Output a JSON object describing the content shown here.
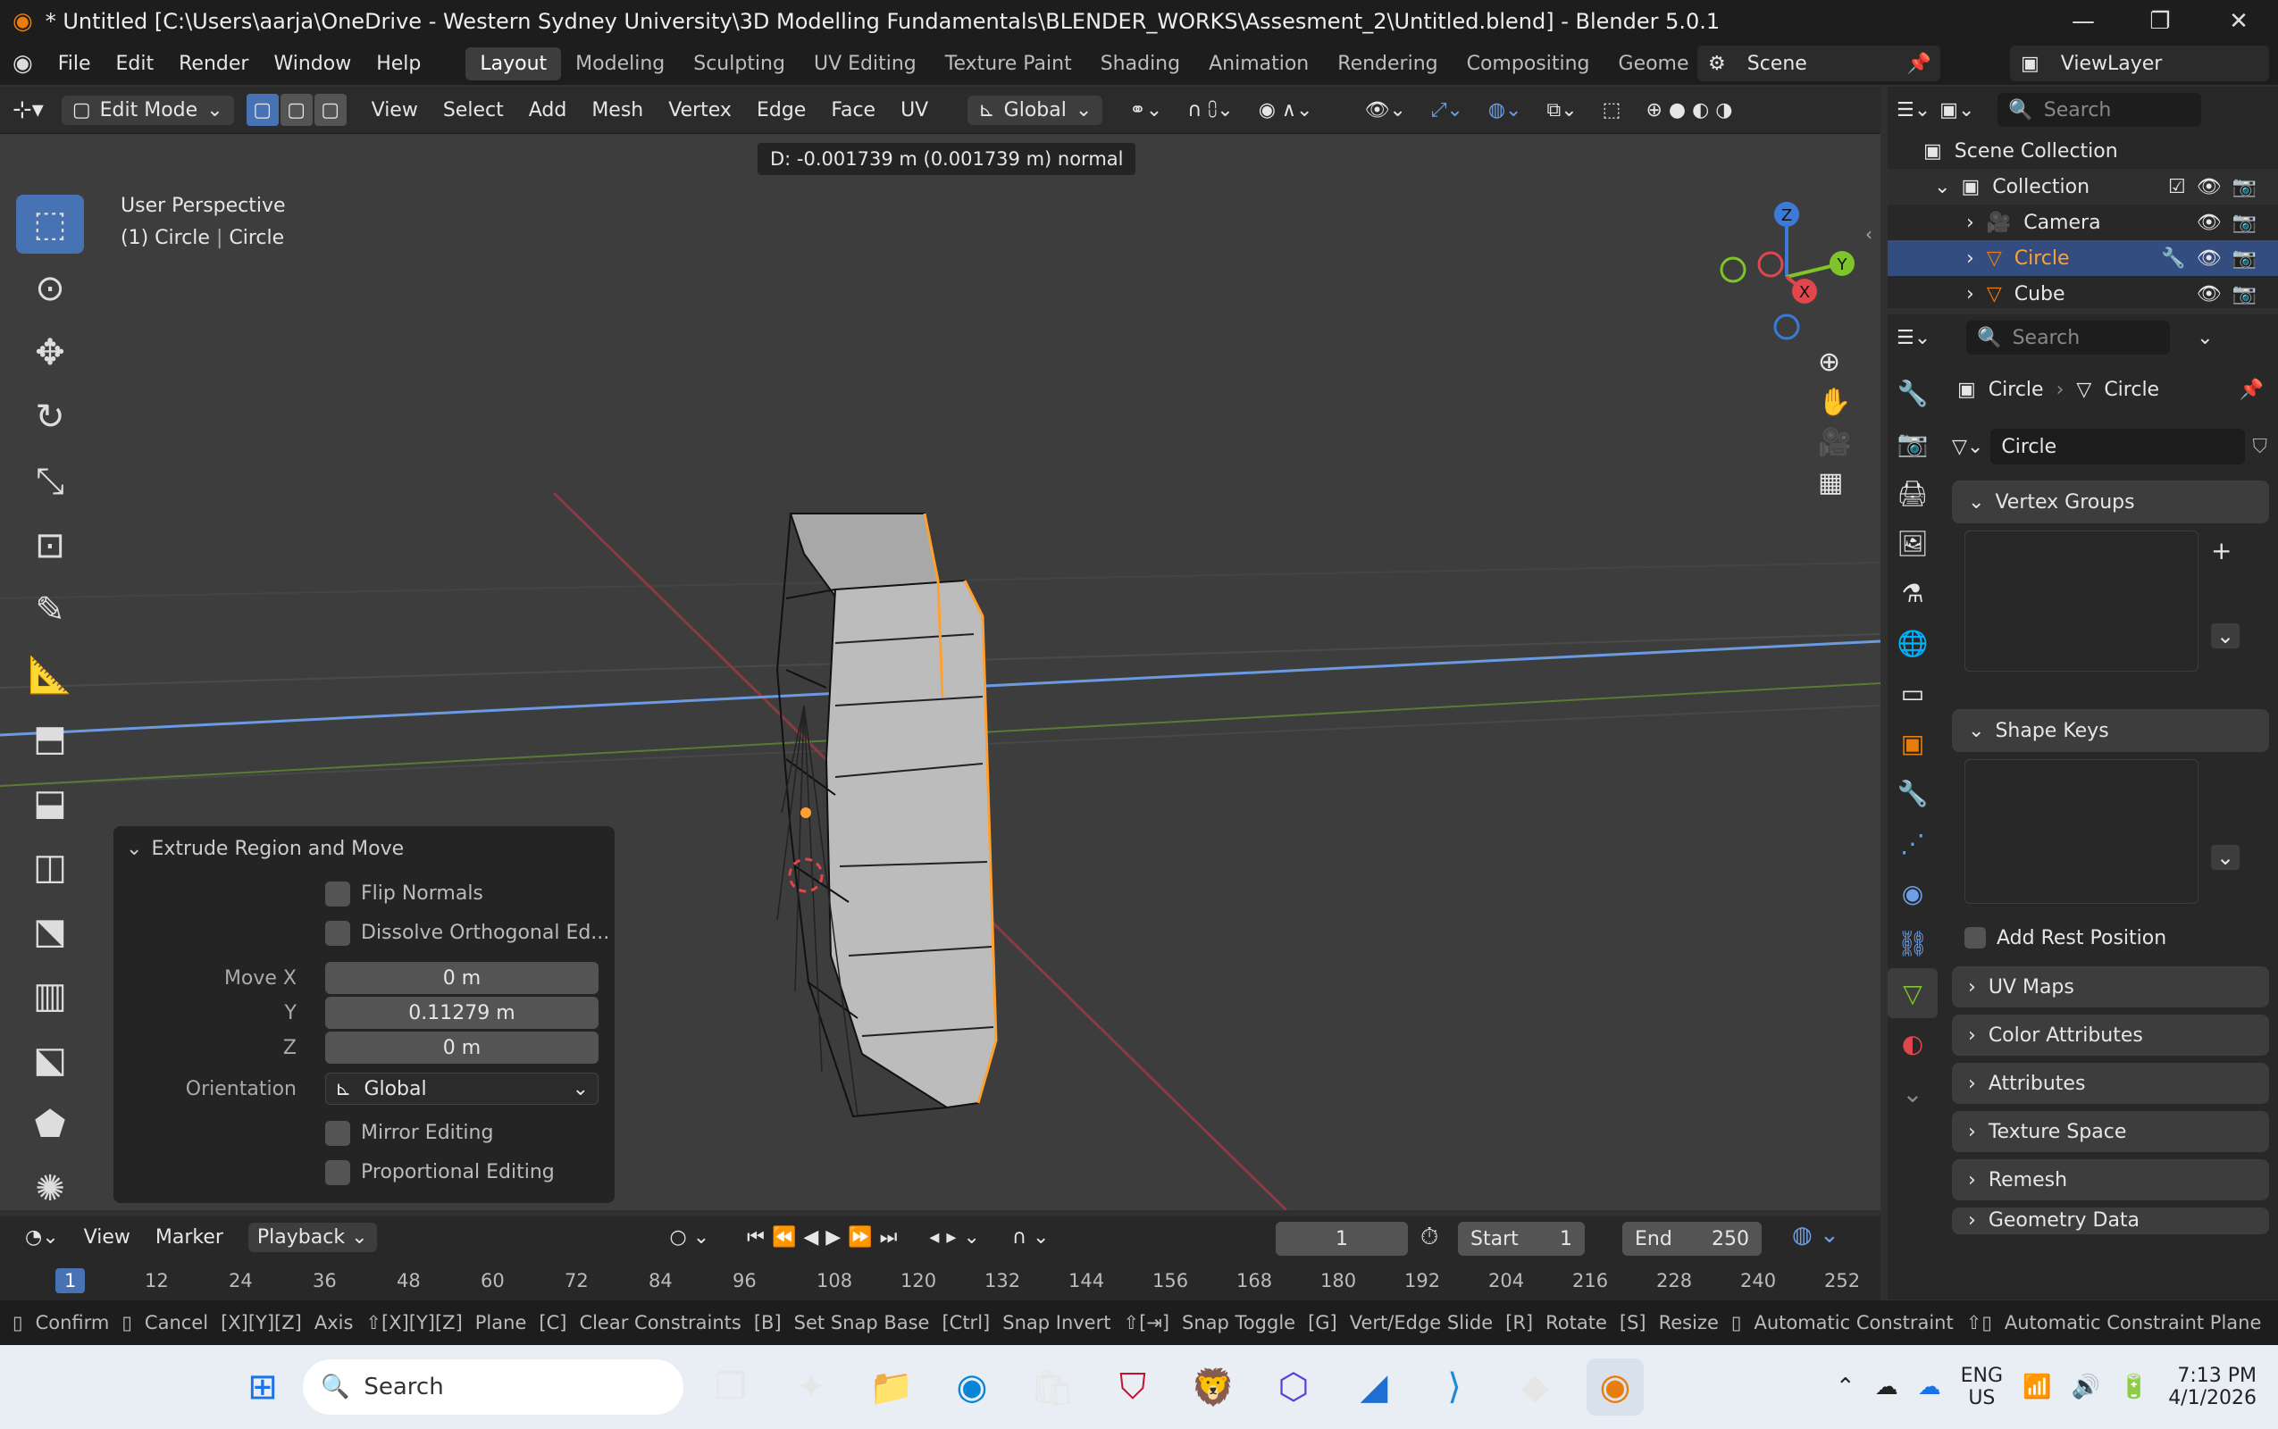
{
  "window": {
    "title": "* Untitled [C:\\Users\\aarja\\OneDrive - Western Sydney University\\3D Modelling Fundamentals\\BLENDER_WORKS\\Assesment_2\\Untitled.blend] - Blender 5.0.1"
  },
  "menu": {
    "items": [
      "File",
      "Edit",
      "Render",
      "Window",
      "Help"
    ],
    "workspaces": [
      "Layout",
      "Modeling",
      "Sculpting",
      "UV Editing",
      "Texture Paint",
      "Shading",
      "Animation",
      "Rendering",
      "Compositing",
      "Geome"
    ],
    "scene": "Scene",
    "view_layer": "ViewLayer"
  },
  "viewport_header": {
    "mode": "Edit Mode",
    "menus": [
      "View",
      "Select",
      "Add",
      "Mesh",
      "Vertex",
      "Edge",
      "Face",
      "UV"
    ],
    "orientation": "Global"
  },
  "viewport": {
    "status_line": "D: -0.001739 m (0.001739 m) normal",
    "perspective": "User Perspective",
    "object_info_prefix": "(1) Circle",
    "object_info_suffix": "Circle",
    "gizmo": {
      "z": "Z",
      "x": "X",
      "y": "Y"
    }
  },
  "operator_panel": {
    "title": "Extrude Region and Move",
    "flip_normals": "Flip Normals",
    "dissolve": "Dissolve Orthogonal Ed...",
    "move_x_label": "Move X",
    "move_x": "0 m",
    "y_label": "Y",
    "y_value": "0.11279 m",
    "z_label": "Z",
    "z_value": "0 m",
    "orientation_label": "Orientation",
    "orientation_value": "Global",
    "mirror": "Mirror Editing",
    "proportional": "Proportional Editing"
  },
  "outliner": {
    "search_placeholder": "Search",
    "scene_collection": "Scene Collection",
    "collection": "Collection",
    "items": [
      "Camera",
      "Circle",
      "Cube"
    ]
  },
  "properties": {
    "search_placeholder": "Search",
    "breadcrumb_object": "Circle",
    "breadcrumb_data": "Circle",
    "mesh_name": "Circle",
    "vertex_groups": "Vertex Groups",
    "shape_keys": "Shape Keys",
    "add_rest_position": "Add Rest Position",
    "collapsed_panels": [
      "UV Maps",
      "Color Attributes",
      "Attributes",
      "Texture Space",
      "Remesh",
      "Geometry Data"
    ]
  },
  "timeline": {
    "menus": [
      "View",
      "Marker",
      "Playback"
    ],
    "current_frame": "1",
    "start_label": "Start",
    "start": "1",
    "end_label": "End",
    "end": "250",
    "ruler": [
      "1",
      "12",
      "24",
      "36",
      "48",
      "60",
      "72",
      "84",
      "96",
      "108",
      "120",
      "132",
      "144",
      "156",
      "168",
      "180",
      "192",
      "204",
      "216",
      "228",
      "240",
      "252"
    ]
  },
  "status_bar": {
    "items": [
      "Confirm",
      "Cancel",
      "Axis",
      "Plane",
      "Clear Constraints",
      "Set Snap Base",
      "Snap Invert",
      "Snap Toggle",
      "Vert/Edge Slide",
      "Rotate",
      "Resize",
      "Automatic Constraint",
      "Automatic Constraint Plane"
    ]
  },
  "taskbar": {
    "search": "Search",
    "lang1": "ENG",
    "lang2": "US",
    "time": "7:13 PM",
    "date": "4/1/2026"
  },
  "colors": {
    "accent": "#4772b3",
    "selected_edge": "#ffa030",
    "x_axis": "#e0464b",
    "y_axis": "#7ec42a",
    "z_axis": "#3b7ad8"
  }
}
